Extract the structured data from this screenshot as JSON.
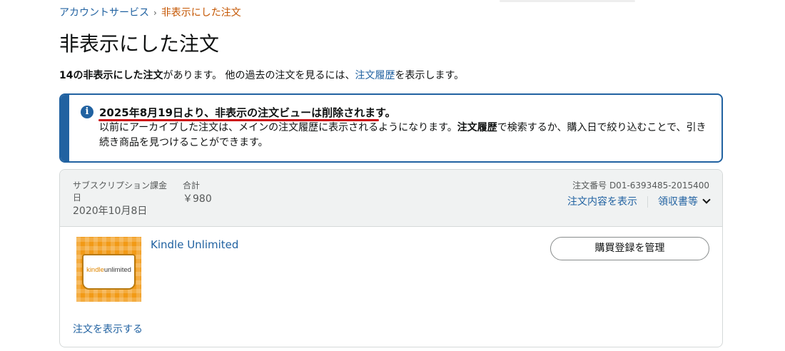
{
  "breadcrumb": {
    "parent": "アカウントサービス",
    "separator": "›",
    "current": "非表示にした注文"
  },
  "page_title": "非表示にした注文",
  "summary": {
    "count_text": "14の非表示にした注文",
    "middle_text": "があります。 他の過去の注文を見るには、",
    "link_text": "注文履歴",
    "end_text": "を表示します。"
  },
  "alert": {
    "icon": "info-icon",
    "heading": "2025年8月19日より、非表示の注文ビューは削除されます。",
    "body_part1": "以前にアーカイブした注文は、メインの注文履歴に表示されるようになります。",
    "body_bold": "注文履歴",
    "body_part2": "で検索するか、購入日で絞り込むことで、引き続き商品を見つけることができます。",
    "accent_color": "#2162a1",
    "underline_color": "#cc0c12"
  },
  "order": {
    "date_label": "サブスクリプション課金日",
    "date_value": "2020年10月8日",
    "total_label": "合計",
    "total_value": "￥980",
    "order_number": "注文番号 D01-6393485-2015400",
    "details_link": "注文内容を表示",
    "receipt_link": "領収書等",
    "product": {
      "image_brand_kindle": "kindle",
      "image_brand_unlimited": "unlimited",
      "title": "Kindle Unlimited",
      "manage_button": "購買登録を管理"
    },
    "view_order_link": "注文を表示する"
  },
  "colors": {
    "link": "#2162a1",
    "breadcrumb_current": "#c45500",
    "header_bg": "#f0f2f2",
    "border": "#d5d9d9"
  }
}
